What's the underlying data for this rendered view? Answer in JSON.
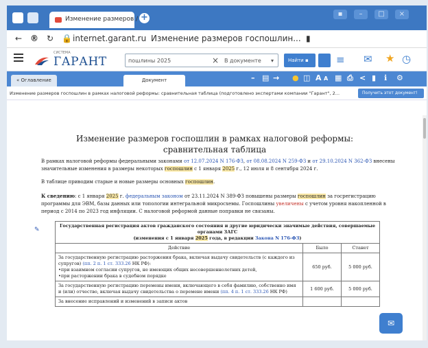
{
  "browser": {
    "tab_title": "Изменение размеров / ×",
    "new_tab": "+",
    "url": "internet.garant.ru",
    "page_title": "Изменение размеров госпошлин..."
  },
  "site": {
    "logo_small": "СИСТЕМА",
    "logo": "ГАРАНТ",
    "search_value": "пошлины 2025",
    "search_clear": "×",
    "scope": "В документе",
    "find_button": "Найти"
  },
  "doc_tabs": {
    "toc": "« Оглавление",
    "document": "Документ"
  },
  "info": {
    "breadcrumb": "Изменение размеров госпошлин в рамках налоговой реформы: сравнительная таблица (подготовлено экспертами компании \"Гарант\", 2...",
    "button": "Получить этот документ!"
  },
  "document": {
    "title_line1": "Изменение размеров госпошлин в рамках налоговой реформы:",
    "title_line2": "сравнительная таблица",
    "p1_a": "В рамках налоговой реформы федеральными законами ",
    "p1_law1": "от 12.07.2024 N 176-ФЗ",
    "p1_c1": ", ",
    "p1_law2": "от 08.08.2024 N 259-ФЗ",
    "p1_and": " и ",
    "p1_law3": "от 29.10.2024 N 362-ФЗ",
    "p1_b": " внесены значительные изменения в размеры некоторых ",
    "p1_hl1": "госпошлин",
    "p1_c": " с 1 января ",
    "p1_hl2": "2025",
    "p1_d": " г., 12 июля и 8 сентября 2024 г.",
    "p2_a": "В таблице приводим старые и новые размеры основных ",
    "p2_hl": "госпошлин",
    "p2_b": ".",
    "p3_bold": "К сведению",
    "p3_a": ": с 1 января ",
    "p3_hl1": "2025",
    "p3_b": " г. ",
    "p3_link": "федеральным законом",
    "p3_c": " от 23.11.2024 N 389-ФЗ повышены размеры ",
    "p3_hl2": "госпошлин",
    "p3_d": " за госрегистрацию программы для ЭВМ, базы данных или топологии интегральной микросхемы. Госпошлины ",
    "p3_red": "увеличены",
    "p3_e": " с учетом уровня накопленной в период с 2014 по 2023 год инфляции. С налоговой реформой данные поправки не связаны.",
    "table_head_1": "Государственная регистрация актов гражданского состояния и другие юридически значимые действия, совершаемые органами ЗАГС",
    "table_head_2a": "(изменения с 1 января ",
    "table_head_2hl": "2025",
    "table_head_2b": " года, в редакции ",
    "table_head_2link": "Закона N 176-ФЗ",
    "table_head_2c": ")",
    "col_action": "Действие",
    "col_was": "Было",
    "col_now": "Станет",
    "row1_a": "За государственную регистрацию расторжения брака, включая выдачу свидетельств (с каждого из супругов) ",
    "row1_link": "(пп. 2 п. 1 ст. 333.26",
    "row1_b": " НК РФ):",
    "row1_c": "•при взаимном согласии супругов, не имеющих общих несовершеннолетних детей,",
    "row1_d": "•при расторжении брака в судебном порядке",
    "row1_was": "650 руб.",
    "row1_now": "5 000 руб.",
    "row2_a": "За государственную регистрацию перемены имени, включающего в себя фамилию, собственно имя и (или) отчество, включая выдачу свидетельства о перемене имени ",
    "row2_link": "(пп. 4 п. 1 ст. 333.26",
    "row2_b": " НК РФ)",
    "row2_was": "1 600 руб.",
    "row2_now": "5 000 руб.",
    "row3_a": "За внесение исправлений и изменений в записи актов"
  }
}
